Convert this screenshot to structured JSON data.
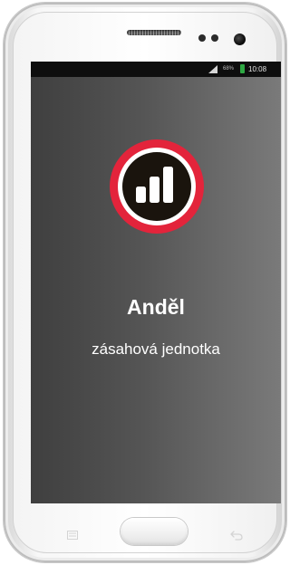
{
  "status_bar": {
    "battery_percent": "68%",
    "time": "10:08",
    "signal_icon": "signal-icon",
    "battery_icon": "battery-icon",
    "battery_color": "#2ea843"
  },
  "app": {
    "logo_icon": "signal-bars-logo",
    "logo_ring_color": "#e3243b",
    "logo_fill_color": "#1a140d",
    "title": "Anděl",
    "subtitle": "zásahová jednotka"
  },
  "navigation": {
    "menu_icon": "menu-icon",
    "home_icon": "home-button",
    "back_icon": "back-icon"
  }
}
